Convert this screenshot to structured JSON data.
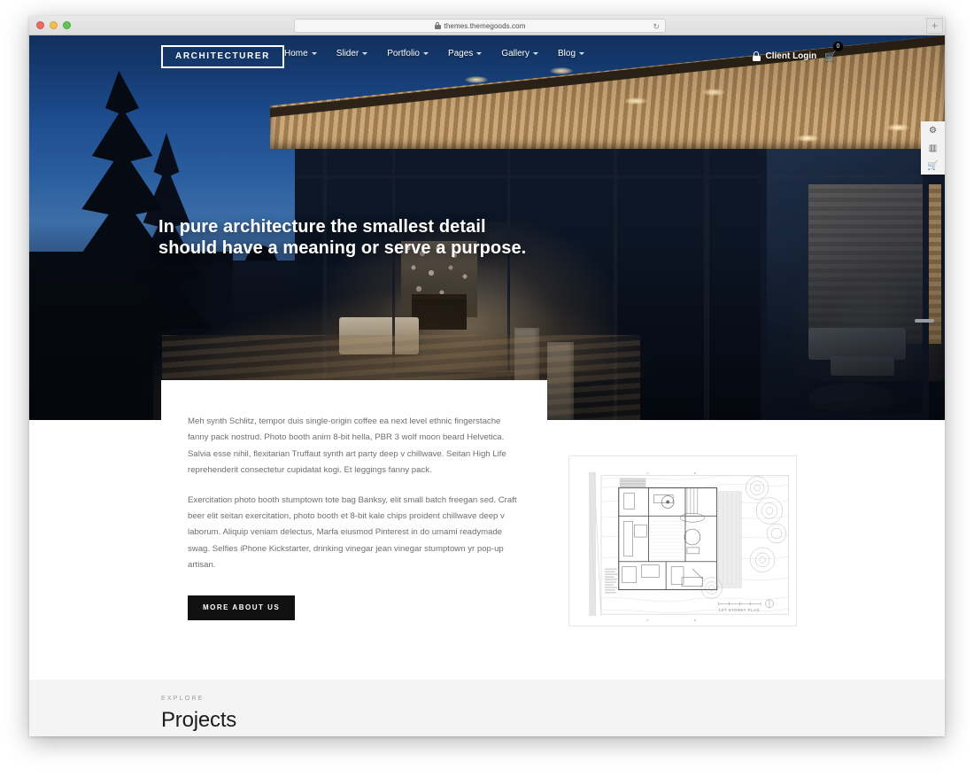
{
  "browser": {
    "url": "themes.themegoods.com",
    "lock_icon": "lock-icon",
    "reload_icon": "↻",
    "new_tab_icon": "+"
  },
  "header": {
    "logo": "ARCHITECTURER",
    "nav": [
      {
        "label": "Home",
        "has_dropdown": true
      },
      {
        "label": "Slider",
        "has_dropdown": true
      },
      {
        "label": "Portfolio",
        "has_dropdown": true
      },
      {
        "label": "Pages",
        "has_dropdown": true
      },
      {
        "label": "Gallery",
        "has_dropdown": true
      },
      {
        "label": "Blog",
        "has_dropdown": true
      }
    ],
    "client_login": "Client Login",
    "cart_icon": "🛒",
    "cart_count": "0"
  },
  "hero": {
    "headline": "In pure architecture the smallest detail\nshould have a meaning or serve a purpose."
  },
  "side_toolbar": [
    {
      "name": "gear-icon",
      "glyph": "⚙"
    },
    {
      "name": "book-icon",
      "glyph": "▥"
    },
    {
      "name": "cart-icon",
      "glyph": "🛒"
    }
  ],
  "about": {
    "paragraph_1": "Meh synth Schlitz, tempor duis single-origin coffee ea next level ethnic fingerstache fanny pack nostrud. Photo booth anim 8-bit hella, PBR 3 wolf moon beard Helvetica. Salvia esse nihil, flexitarian Truffaut synth art party deep v chillwave. Seitan High Life reprehenderit consectetur cupidatat kogi. Et leggings fanny pack.",
    "paragraph_2": "Exercitation photo booth stumptown tote bag Banksy, elit small batch freegan sed. Craft beer elit seitan exercitation, photo booth et 8-bit kale chips proident chillwave deep v laborum. Aliquip veniam delectus, Marfa eiusmod Pinterest in do umami readymade swag. Selfies iPhone Kickstarter, drinking vinegar jean vinegar stumptown yr pop-up artisan.",
    "button": "MORE ABOUT US"
  },
  "floor_plan": {
    "caption": "1ST STOREY PLAN"
  },
  "projects": {
    "eyebrow": "EXPLORE",
    "title": "Projects"
  },
  "colors": {
    "accent_dark": "#111111",
    "page_bg": "#ffffff",
    "section_bg": "#f4f4f4",
    "body_text": "#6f6f6f",
    "heading_text": "#1c1c1c"
  }
}
